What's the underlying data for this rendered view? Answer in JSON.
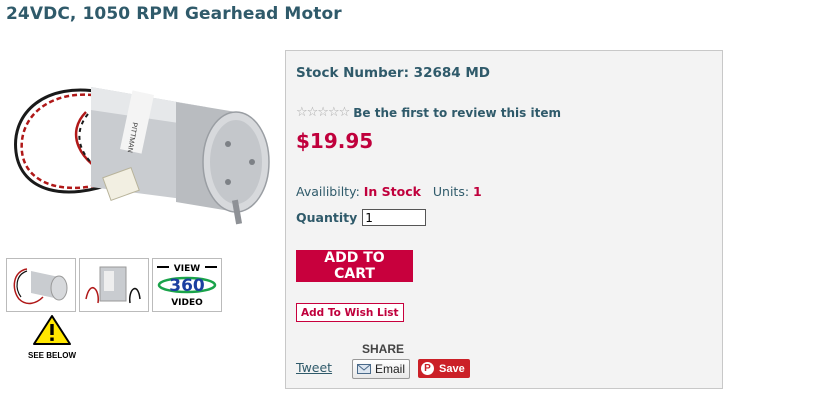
{
  "product": {
    "title": "24VDC, 1050 RPM Gearhead Motor",
    "motor_label": "PITTMAN"
  },
  "gallery": {
    "main_image": "gearhead-motor-photo",
    "thumbnails": [
      "motor-thumb-1",
      "motor-thumb-2",
      "view-360-video"
    ],
    "view360": {
      "top": "VIEW",
      "middle": "360",
      "bottom": "VIDEO"
    },
    "warning_label": "SEE BELOW"
  },
  "details": {
    "stock_label": "Stock Number: 32684 MD",
    "stars": "☆☆☆☆☆",
    "review_link": "Be the first to review this item",
    "price": "$19.95",
    "availability_label": "Availibilty:",
    "availability_value": "In Stock",
    "units_label": "Units:",
    "units_value": "1",
    "quantity_label": "Quantity",
    "quantity_value": "1",
    "add_to_cart": "ADD TO CART",
    "add_to_wishlist": "Add To Wish List"
  },
  "share": {
    "label": "SHARE",
    "tweet": "Tweet",
    "email": "Email",
    "save": "Save",
    "pin_glyph": "P"
  },
  "colors": {
    "title_blue": "#2f5a6a",
    "price_red": "#c0003c",
    "cart_red": "#c8003d",
    "pinterest_red": "#cb2027"
  }
}
